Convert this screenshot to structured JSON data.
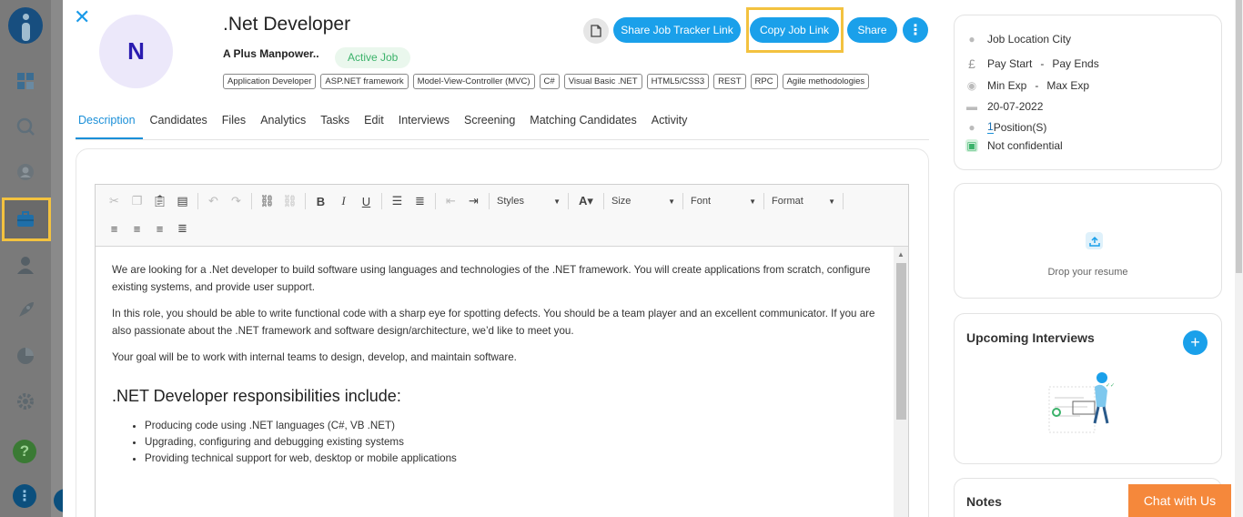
{
  "job": {
    "avatar_letter": "N",
    "title": ".Net Developer",
    "company": "A Plus Manpower..",
    "status": "Active Job",
    "tags": [
      "Application Developer",
      "ASP.NET framework",
      "Model-View-Controller (MVC)",
      "C#",
      "Visual Basic .NET",
      "HTML5/CSS3",
      "REST",
      "RPC",
      "Agile methodologies"
    ]
  },
  "actions": {
    "share_tracker": "Share Job Tracker Link",
    "copy_link": "Copy Job Link",
    "share": "Share",
    "more": "⋮"
  },
  "tabs": [
    "Description",
    "Candidates",
    "Files",
    "Analytics",
    "Tasks",
    "Edit",
    "Interviews",
    "Screening",
    "Matching Candidates",
    "Activity"
  ],
  "editor": {
    "combos": {
      "styles": "Styles",
      "size": "Size",
      "font": "Font",
      "format": "Format"
    },
    "para1": "We are looking for a .Net developer to build software using languages and technologies of the .NET framework. You will create applications from scratch, configure existing systems, and provide user support.",
    "para2": "In this role, you should be able to write functional code with a sharp eye for spotting defects. You should be a team player and an excellent communicator. If you are also passionate about the .NET framework and software design/architecture, we’d like to meet you.",
    "para3": "Your goal will be to work with internal teams to design, develop, and maintain software.",
    "heading": ".NET Developer responsibilities include:",
    "bullets": [
      "Producing code using .NET languages (C#, VB .NET)",
      "Upgrading, configuring and debugging existing systems",
      "Providing technical support for web, desktop or mobile applications"
    ]
  },
  "info": {
    "location": "Job Location City",
    "pay_start": "Pay Start",
    "pay_dash": "-",
    "pay_ends": "Pay Ends",
    "min_exp": "Min Exp",
    "exp_dash": "-",
    "max_exp": "Max Exp",
    "date": "20-07-2022",
    "positions_count": "1",
    "positions_label": " Position(S)",
    "confidential": "Not confidential",
    "currency_symbol": "£"
  },
  "resume": {
    "drop_label": "Drop your resume"
  },
  "interviews": {
    "title": "Upcoming Interviews",
    "add": "+"
  },
  "notes": {
    "title": "Notes"
  },
  "chat": {
    "label": "Chat with Us"
  },
  "sidebar": {
    "help": "?",
    "more": "⋮"
  },
  "close": "✕",
  "colors": {
    "accent": "#1aa0ea",
    "highlight": "#f3c23f",
    "active_green": "#3bb26a",
    "chat": "#f5883b"
  }
}
